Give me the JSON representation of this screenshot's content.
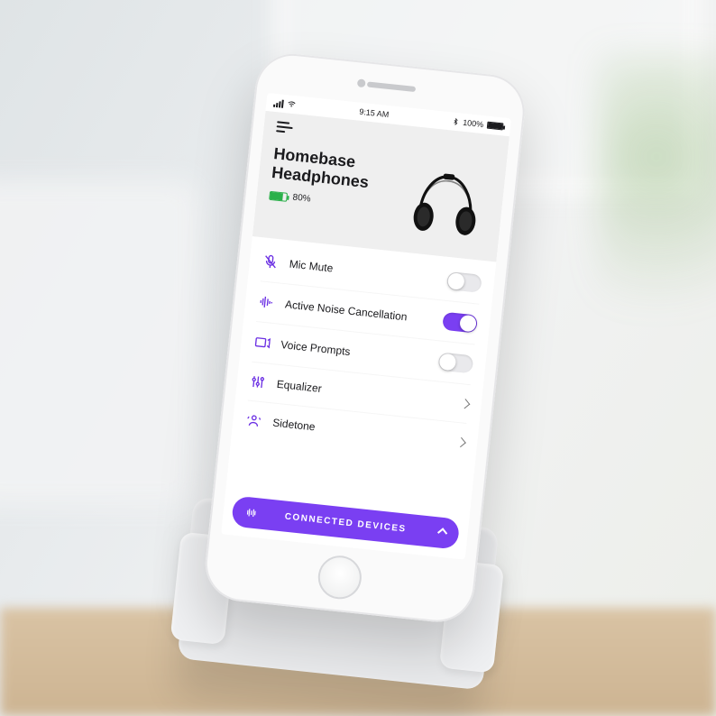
{
  "statusbar": {
    "time": "9:15 AM",
    "battery_text": "100%",
    "bluetooth": true
  },
  "device": {
    "name_line1": "Homebase",
    "name_line2": "Headphones",
    "battery_pct": "80%"
  },
  "settings": {
    "mic_mute": {
      "label": "Mic Mute",
      "on": false
    },
    "anc": {
      "label": "Active Noise Cancellation",
      "on": true
    },
    "voice_prompts": {
      "label": "Voice Prompts",
      "on": false
    },
    "equalizer": {
      "label": "Equalizer"
    },
    "sidetone": {
      "label": "Sidetone"
    }
  },
  "footer": {
    "label": "CONNECTED DEVICES"
  },
  "colors": {
    "accent": "#7a3ff2"
  }
}
